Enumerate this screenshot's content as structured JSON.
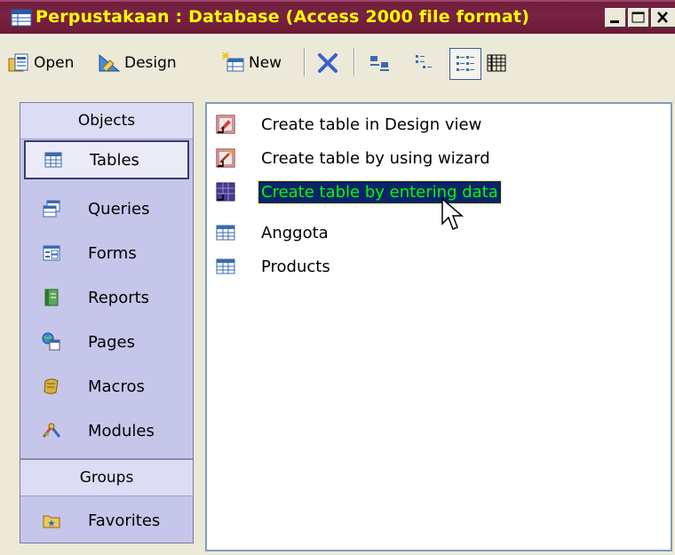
{
  "window": {
    "title": "Perpustakaan : Database (Access 2000 file format)",
    "icon": "database-window-icon"
  },
  "toolbar": {
    "open_label": "Open",
    "design_label": "Design",
    "new_label": "New"
  },
  "objects": {
    "header": "Objects",
    "items": [
      {
        "label": "Tables",
        "icon": "tables-icon",
        "selected": true
      },
      {
        "label": "Queries",
        "icon": "queries-icon"
      },
      {
        "label": "Forms",
        "icon": "forms-icon"
      },
      {
        "label": "Reports",
        "icon": "reports-icon"
      },
      {
        "label": "Pages",
        "icon": "pages-icon"
      },
      {
        "label": "Macros",
        "icon": "macros-icon"
      },
      {
        "label": "Modules",
        "icon": "modules-icon"
      }
    ]
  },
  "groups": {
    "header": "Groups",
    "items": [
      {
        "label": "Favorites",
        "icon": "favorites-folder-icon"
      }
    ]
  },
  "list": {
    "items": [
      {
        "label": "Create table in Design view",
        "icon": "shortcut-design-icon"
      },
      {
        "label": "Create table by using wizard",
        "icon": "shortcut-wizard-icon"
      },
      {
        "label": "Create table by entering data",
        "icon": "shortcut-datasheet-icon",
        "selected": true
      },
      {
        "label": "Anggota",
        "icon": "table-icon"
      },
      {
        "label": "Products",
        "icon": "table-icon"
      }
    ]
  },
  "colors": {
    "title_bar": "#6d1f3a",
    "title_text": "#ffff00",
    "selection_bg": "#0a246a",
    "selection_text": "#00ff00",
    "objects_bar": "#c6c6ea"
  }
}
